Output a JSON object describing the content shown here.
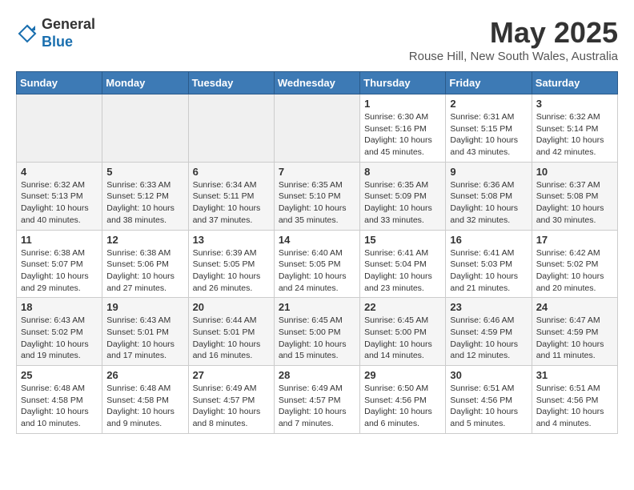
{
  "header": {
    "logo_line1": "General",
    "logo_line2": "Blue",
    "month_title": "May 2025",
    "location": "Rouse Hill, New South Wales, Australia"
  },
  "days_of_week": [
    "Sunday",
    "Monday",
    "Tuesday",
    "Wednesday",
    "Thursday",
    "Friday",
    "Saturday"
  ],
  "weeks": [
    [
      {
        "day": "",
        "info": ""
      },
      {
        "day": "",
        "info": ""
      },
      {
        "day": "",
        "info": ""
      },
      {
        "day": "",
        "info": ""
      },
      {
        "day": "1",
        "info": "Sunrise: 6:30 AM\nSunset: 5:16 PM\nDaylight: 10 hours\nand 45 minutes."
      },
      {
        "day": "2",
        "info": "Sunrise: 6:31 AM\nSunset: 5:15 PM\nDaylight: 10 hours\nand 43 minutes."
      },
      {
        "day": "3",
        "info": "Sunrise: 6:32 AM\nSunset: 5:14 PM\nDaylight: 10 hours\nand 42 minutes."
      }
    ],
    [
      {
        "day": "4",
        "info": "Sunrise: 6:32 AM\nSunset: 5:13 PM\nDaylight: 10 hours\nand 40 minutes."
      },
      {
        "day": "5",
        "info": "Sunrise: 6:33 AM\nSunset: 5:12 PM\nDaylight: 10 hours\nand 38 minutes."
      },
      {
        "day": "6",
        "info": "Sunrise: 6:34 AM\nSunset: 5:11 PM\nDaylight: 10 hours\nand 37 minutes."
      },
      {
        "day": "7",
        "info": "Sunrise: 6:35 AM\nSunset: 5:10 PM\nDaylight: 10 hours\nand 35 minutes."
      },
      {
        "day": "8",
        "info": "Sunrise: 6:35 AM\nSunset: 5:09 PM\nDaylight: 10 hours\nand 33 minutes."
      },
      {
        "day": "9",
        "info": "Sunrise: 6:36 AM\nSunset: 5:08 PM\nDaylight: 10 hours\nand 32 minutes."
      },
      {
        "day": "10",
        "info": "Sunrise: 6:37 AM\nSunset: 5:08 PM\nDaylight: 10 hours\nand 30 minutes."
      }
    ],
    [
      {
        "day": "11",
        "info": "Sunrise: 6:38 AM\nSunset: 5:07 PM\nDaylight: 10 hours\nand 29 minutes."
      },
      {
        "day": "12",
        "info": "Sunrise: 6:38 AM\nSunset: 5:06 PM\nDaylight: 10 hours\nand 27 minutes."
      },
      {
        "day": "13",
        "info": "Sunrise: 6:39 AM\nSunset: 5:05 PM\nDaylight: 10 hours\nand 26 minutes."
      },
      {
        "day": "14",
        "info": "Sunrise: 6:40 AM\nSunset: 5:05 PM\nDaylight: 10 hours\nand 24 minutes."
      },
      {
        "day": "15",
        "info": "Sunrise: 6:41 AM\nSunset: 5:04 PM\nDaylight: 10 hours\nand 23 minutes."
      },
      {
        "day": "16",
        "info": "Sunrise: 6:41 AM\nSunset: 5:03 PM\nDaylight: 10 hours\nand 21 minutes."
      },
      {
        "day": "17",
        "info": "Sunrise: 6:42 AM\nSunset: 5:02 PM\nDaylight: 10 hours\nand 20 minutes."
      }
    ],
    [
      {
        "day": "18",
        "info": "Sunrise: 6:43 AM\nSunset: 5:02 PM\nDaylight: 10 hours\nand 19 minutes."
      },
      {
        "day": "19",
        "info": "Sunrise: 6:43 AM\nSunset: 5:01 PM\nDaylight: 10 hours\nand 17 minutes."
      },
      {
        "day": "20",
        "info": "Sunrise: 6:44 AM\nSunset: 5:01 PM\nDaylight: 10 hours\nand 16 minutes."
      },
      {
        "day": "21",
        "info": "Sunrise: 6:45 AM\nSunset: 5:00 PM\nDaylight: 10 hours\nand 15 minutes."
      },
      {
        "day": "22",
        "info": "Sunrise: 6:45 AM\nSunset: 5:00 PM\nDaylight: 10 hours\nand 14 minutes."
      },
      {
        "day": "23",
        "info": "Sunrise: 6:46 AM\nSunset: 4:59 PM\nDaylight: 10 hours\nand 12 minutes."
      },
      {
        "day": "24",
        "info": "Sunrise: 6:47 AM\nSunset: 4:59 PM\nDaylight: 10 hours\nand 11 minutes."
      }
    ],
    [
      {
        "day": "25",
        "info": "Sunrise: 6:48 AM\nSunset: 4:58 PM\nDaylight: 10 hours\nand 10 minutes."
      },
      {
        "day": "26",
        "info": "Sunrise: 6:48 AM\nSunset: 4:58 PM\nDaylight: 10 hours\nand 9 minutes."
      },
      {
        "day": "27",
        "info": "Sunrise: 6:49 AM\nSunset: 4:57 PM\nDaylight: 10 hours\nand 8 minutes."
      },
      {
        "day": "28",
        "info": "Sunrise: 6:49 AM\nSunset: 4:57 PM\nDaylight: 10 hours\nand 7 minutes."
      },
      {
        "day": "29",
        "info": "Sunrise: 6:50 AM\nSunset: 4:56 PM\nDaylight: 10 hours\nand 6 minutes."
      },
      {
        "day": "30",
        "info": "Sunrise: 6:51 AM\nSunset: 4:56 PM\nDaylight: 10 hours\nand 5 minutes."
      },
      {
        "day": "31",
        "info": "Sunrise: 6:51 AM\nSunset: 4:56 PM\nDaylight: 10 hours\nand 4 minutes."
      }
    ]
  ]
}
